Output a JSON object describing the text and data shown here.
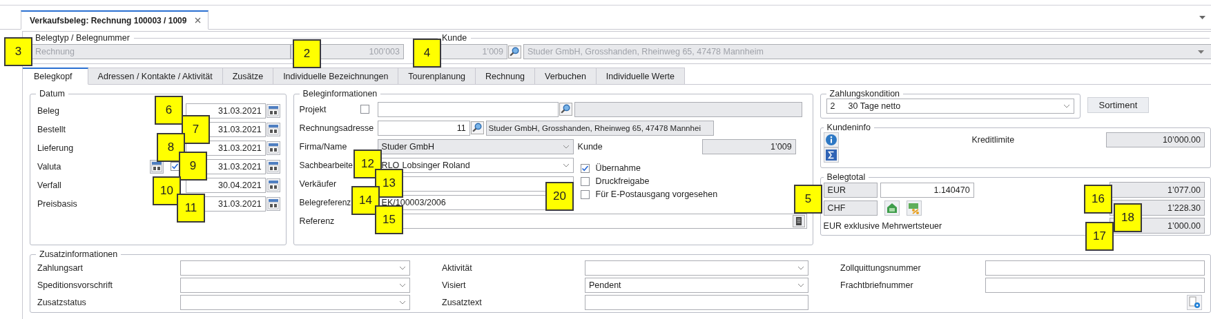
{
  "document_tab": {
    "title": "Verkaufsbeleg: Rechnung 100003 / 1009"
  },
  "header": {
    "belegtyp_legend": "Belegtyp / Belegnummer",
    "belegtyp": "Rechnung",
    "belegnummer": "100’003",
    "kunde_legend": "Kunde",
    "kunde_nummer": "1’009",
    "kunde_adresse": "Studer GmbH, Grosshanden, Rheinweg 65, 47478 Mannheim"
  },
  "tabs": [
    {
      "label": "Belegkopf",
      "selected": true
    },
    {
      "label": "Adressen / Kontakte / Aktivität",
      "selected": false
    },
    {
      "label": "Zusätze",
      "selected": false
    },
    {
      "label": "Individuelle Bezeichnungen",
      "selected": false
    },
    {
      "label": "Tourenplanung",
      "selected": false
    },
    {
      "label": "Rechnung",
      "selected": false
    },
    {
      "label": "Verbuchen",
      "selected": false
    },
    {
      "label": "Individuelle Werte",
      "selected": false
    }
  ],
  "datum": {
    "legend": "Datum",
    "rows": [
      {
        "label": "Beleg",
        "date": "31.03.2021",
        "kind": "date"
      },
      {
        "label": "Bestellt",
        "date": "31.03.2021",
        "kind": "date"
      },
      {
        "label": "Lieferung",
        "date": "31.03.2021",
        "kind": "date"
      },
      {
        "label": "Valuta",
        "date": "31.03.2021",
        "kind": "date-check",
        "checked": true
      },
      {
        "label": "Verfall",
        "date": "30.04.2021",
        "kind": "date"
      },
      {
        "label": "Preisbasis",
        "date": "31.03.2021",
        "kind": "date"
      }
    ]
  },
  "beleginfo": {
    "legend": "Beleginformationen",
    "projekt": {
      "label": "Projekt",
      "checked": false
    },
    "rechnungsadresse": {
      "label": "Rechnungsadresse",
      "value": "11",
      "address": "Studer GmbH, Grosshanden, Rheinweg 65, 47478 Mannhei"
    },
    "firma": {
      "label": "Firma/Name",
      "value": "Studer GmbH"
    },
    "kunde": {
      "label": "Kunde",
      "value": "1’009"
    },
    "sachbearbeiter": {
      "label": "Sachbearbeite",
      "code": "RLO",
      "name": "Lobsinger Roland"
    },
    "verkaeufer": {
      "label": "Verkäufer"
    },
    "belegreferenz": {
      "label": "Belegreferenz",
      "value": "EK/100003/2006"
    },
    "referenz": {
      "label": "Referenz"
    },
    "options": [
      {
        "label": "Übernahme",
        "checked": true
      },
      {
        "label": "Druckfreigabe",
        "checked": false
      },
      {
        "label": "Für E-Postausgang vorgesehen",
        "checked": false
      }
    ]
  },
  "zahlungskondition": {
    "legend": "Zahlungskondition",
    "code": "2",
    "text": "30 Tage netto"
  },
  "sortiment_button": "Sortiment",
  "kundeninfo": {
    "legend": "Kundeninfo",
    "label": "Kreditlimite",
    "value": "10’000.00"
  },
  "belegtotal": {
    "legend": "Belegtotal",
    "currency_1": "EUR",
    "rate": "1.140470",
    "currency_2": "CHF",
    "net_label": "EUR exklusive Mehrwertsteuer",
    "totals": [
      "1’077.00",
      "1’228.30",
      "1’000.00"
    ]
  },
  "zusatzinfo": {
    "legend": "Zusatzinformationen",
    "fields": [
      {
        "label": "Zahlungsart",
        "kind": "combo"
      },
      {
        "label": "Speditionsvorschrift",
        "kind": "combo"
      },
      {
        "label": "Zusatzstatus",
        "kind": "combo"
      },
      {
        "label": "Aktivität",
        "kind": "combo"
      },
      {
        "label": "Visiert",
        "kind": "combo",
        "value": "Pendent"
      },
      {
        "label": "Zusatztext",
        "kind": "text"
      },
      {
        "label": "Zollquittungsnummer",
        "kind": "text"
      },
      {
        "label": "Frachtbriefnummer",
        "kind": "text"
      },
      {
        "kind": "button"
      }
    ]
  },
  "callouts": [
    {
      "number": "3"
    },
    {
      "number": "2"
    },
    {
      "number": "4"
    },
    {
      "number": "6"
    },
    {
      "number": "7"
    },
    {
      "number": "8"
    },
    {
      "number": "9"
    },
    {
      "number": "10"
    },
    {
      "number": "11"
    },
    {
      "number": "12"
    },
    {
      "number": "13"
    },
    {
      "number": "14"
    },
    {
      "number": "15"
    },
    {
      "number": "20"
    },
    {
      "number": "5"
    },
    {
      "number": "16"
    },
    {
      "number": "18"
    },
    {
      "number": "17"
    }
  ]
}
